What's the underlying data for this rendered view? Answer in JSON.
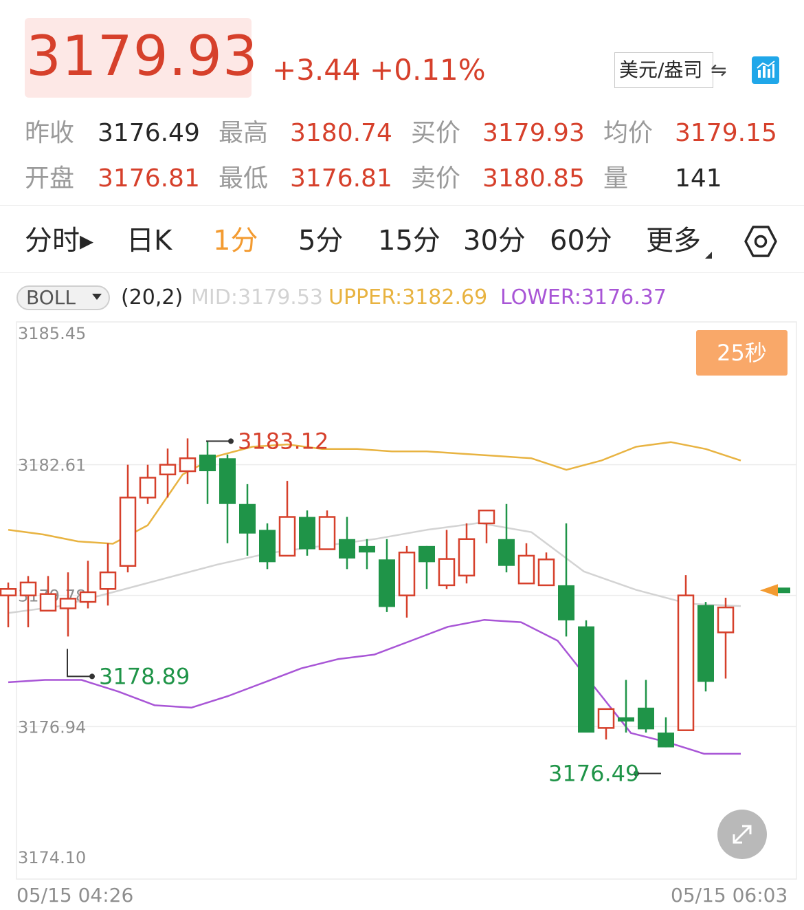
{
  "header": {
    "price": "3179.93",
    "change": "+3.44 +0.11%",
    "unit_label": "美元/盎司",
    "swap_icon": "swap-arrows-icon",
    "chart_icon": "bar-chart-icon"
  },
  "quotes": [
    {
      "label": "昨收",
      "value": "3176.49",
      "color": "#262626"
    },
    {
      "label": "最高",
      "value": "3180.74",
      "color": "#d6402b"
    },
    {
      "label": "买价",
      "value": "3179.93",
      "color": "#d6402b"
    },
    {
      "label": "均价",
      "value": "3179.15",
      "color": "#d6402b"
    },
    {
      "label": "开盘",
      "value": "3176.81",
      "color": "#d6402b"
    },
    {
      "label": "最低",
      "value": "3176.81",
      "color": "#d6402b"
    },
    {
      "label": "卖价",
      "value": "3180.85",
      "color": "#d6402b"
    },
    {
      "label": "量",
      "value": "141",
      "color": "#262626"
    }
  ],
  "tabs": [
    {
      "label": "分时▸",
      "active": false
    },
    {
      "label": "日K",
      "active": false
    },
    {
      "label": "1分",
      "active": true
    },
    {
      "label": "5分",
      "active": false
    },
    {
      "label": "15分",
      "active": false
    },
    {
      "label": "30分",
      "active": false
    },
    {
      "label": "60分",
      "active": false
    },
    {
      "label": "更多",
      "active": false
    }
  ],
  "indicator": {
    "name": "BOLL",
    "params": "(20,2)",
    "mid": "MID:3179.53",
    "upper": "UPPER:3182.69",
    "lower": "LOWER:3176.37"
  },
  "timer": "25秒",
  "colors": {
    "up": "#d6402b",
    "down": "#1f9448",
    "upper": "#e8b341",
    "lower": "#a855d6",
    "mid": "#d3d3d3",
    "accent": "#f39b31"
  },
  "chart_data": {
    "type": "candlestick",
    "y_ticks": [
      "3185.45",
      "3182.61",
      "3179.78",
      "3176.94",
      "3174.10"
    ],
    "ylim": [
      3174.1,
      3185.45
    ],
    "x_labels": [
      "05/15 04:26",
      "05/15 06:03"
    ],
    "annotations": [
      {
        "text": "3183.12",
        "value": 3183.12,
        "color": "#d6402b"
      },
      {
        "text": "3178.89",
        "value": 3178.89,
        "color": "#1f9448"
      },
      {
        "text": "3176.49",
        "value": 3176.49,
        "color": "#1f9448"
      }
    ],
    "candles": [
      {
        "o": 3179.78,
        "c": 3179.92,
        "h": 3180.06,
        "l": 3179.09
      },
      {
        "o": 3179.78,
        "c": 3180.06,
        "h": 3180.2,
        "l": 3179.09
      },
      {
        "o": 3179.45,
        "c": 3179.81,
        "h": 3180.2,
        "l": 3179.45
      },
      {
        "o": 3179.5,
        "c": 3179.71,
        "h": 3180.28,
        "l": 3178.89
      },
      {
        "o": 3179.64,
        "c": 3179.85,
        "h": 3180.53,
        "l": 3179.5
      },
      {
        "o": 3179.92,
        "c": 3180.28,
        "h": 3180.91,
        "l": 3179.56
      },
      {
        "o": 3180.42,
        "c": 3181.9,
        "h": 3182.61,
        "l": 3180.28
      },
      {
        "o": 3181.9,
        "c": 3182.33,
        "h": 3182.61,
        "l": 3181.76
      },
      {
        "o": 3182.4,
        "c": 3182.61,
        "h": 3182.96,
        "l": 3181.9
      },
      {
        "o": 3182.47,
        "c": 3182.75,
        "h": 3183.18,
        "l": 3182.19
      },
      {
        "o": 3182.83,
        "c": 3182.47,
        "h": 3183.12,
        "l": 3181.76
      },
      {
        "o": 3182.75,
        "c": 3181.76,
        "h": 3182.83,
        "l": 3180.91
      },
      {
        "o": 3181.76,
        "c": 3181.12,
        "h": 3182.19,
        "l": 3180.64
      },
      {
        "o": 3181.2,
        "c": 3180.5,
        "h": 3181.34,
        "l": 3180.35
      },
      {
        "o": 3180.64,
        "c": 3181.48,
        "h": 3182.26,
        "l": 3180.64
      },
      {
        "o": 3181.48,
        "c": 3180.78,
        "h": 3181.62,
        "l": 3180.64
      },
      {
        "o": 3180.78,
        "c": 3181.48,
        "h": 3181.62,
        "l": 3180.78
      },
      {
        "o": 3181.0,
        "c": 3180.58,
        "h": 3181.48,
        "l": 3180.35
      },
      {
        "o": 3180.85,
        "c": 3180.71,
        "h": 3181.0,
        "l": 3180.35
      },
      {
        "o": 3180.56,
        "c": 3179.53,
        "h": 3181.0,
        "l": 3179.42
      },
      {
        "o": 3179.78,
        "c": 3180.71,
        "h": 3180.85,
        "l": 3179.3
      },
      {
        "o": 3180.85,
        "c": 3180.5,
        "h": 3180.85,
        "l": 3179.92
      },
      {
        "o": 3180.0,
        "c": 3180.57,
        "h": 3181.2,
        "l": 3179.92
      },
      {
        "o": 3180.21,
        "c": 3181.0,
        "h": 3181.34,
        "l": 3180.04
      },
      {
        "o": 3181.34,
        "c": 3181.62,
        "h": 3181.62,
        "l": 3180.91
      },
      {
        "o": 3181.0,
        "c": 3180.42,
        "h": 3181.76,
        "l": 3180.28
      },
      {
        "o": 3180.04,
        "c": 3180.64,
        "h": 3180.91,
        "l": 3180.04
      },
      {
        "o": 3180.0,
        "c": 3180.56,
        "h": 3180.71,
        "l": 3180.0
      },
      {
        "o": 3180.0,
        "c": 3179.24,
        "h": 3181.34,
        "l": 3178.89
      },
      {
        "o": 3179.11,
        "c": 3176.81,
        "h": 3179.24,
        "l": 3176.81
      },
      {
        "o": 3176.91,
        "c": 3177.32,
        "h": 3177.32,
        "l": 3176.66
      },
      {
        "o": 3177.14,
        "c": 3177.05,
        "h": 3177.95,
        "l": 3176.81
      },
      {
        "o": 3177.35,
        "c": 3176.88,
        "h": 3177.95,
        "l": 3176.81
      },
      {
        "o": 3176.81,
        "c": 3176.49,
        "h": 3177.14,
        "l": 3176.49
      },
      {
        "o": 3176.86,
        "c": 3179.78,
        "h": 3180.22,
        "l": 3176.86
      },
      {
        "o": 3179.57,
        "c": 3177.91,
        "h": 3179.64,
        "l": 3177.7
      },
      {
        "o": 3178.98,
        "c": 3179.52,
        "h": 3179.73,
        "l": 3177.98
      },
      {
        "o": 3179.92,
        "c": 3179.92,
        "h": 3179.92,
        "l": 3179.92
      }
    ],
    "boll_upper": [
      3181.2,
      3181.1,
      3180.95,
      3180.9,
      3181.3,
      3182.4,
      3182.8,
      3183.0,
      3183.05,
      3182.95,
      3182.95,
      3182.9,
      3182.9,
      3182.85,
      3182.8,
      3182.75,
      3182.5,
      3182.7,
      3183.0,
      3183.1,
      3182.95,
      3182.7
    ],
    "boll_mid": [
      3179.4,
      3179.55,
      3179.85,
      3180.15,
      3180.45,
      3180.7,
      3180.85,
      3181.0,
      3181.2,
      3181.35,
      3181.15,
      3180.3,
      3179.9,
      3179.6,
      3179.55
    ],
    "boll_lower": [
      3177.9,
      3177.95,
      3177.95,
      3177.7,
      3177.4,
      3177.35,
      3177.6,
      3177.9,
      3178.2,
      3178.4,
      3178.5,
      3178.8,
      3179.1,
      3179.25,
      3179.2,
      3178.8,
      3177.8,
      3176.8,
      3176.6,
      3176.35,
      3176.35
    ]
  }
}
